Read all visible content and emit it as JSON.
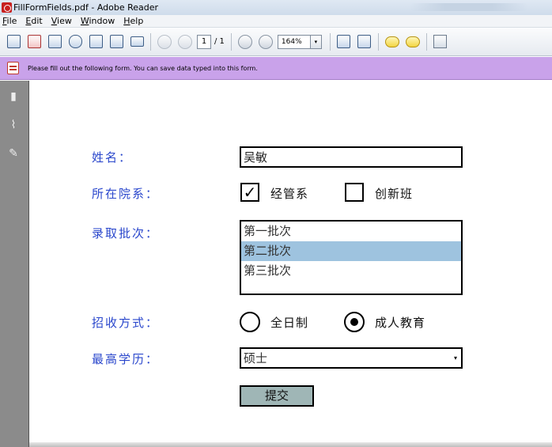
{
  "window": {
    "title": "FillFormFields.pdf - Adobe Reader"
  },
  "menu": {
    "items": [
      "File",
      "Edit",
      "View",
      "Window",
      "Help"
    ]
  },
  "toolbar": {
    "page_current": "1",
    "page_total": "/ 1",
    "zoom": "164%",
    "zoom_arrow": "▾"
  },
  "message_bar": {
    "text": "Please fill out the following form. You can save data typed into this form."
  },
  "form": {
    "name_label": "姓名：",
    "name_value": "吴敏",
    "dept_label": "所在院系：",
    "dept_options": [
      {
        "label": "经管系",
        "checked": true
      },
      {
        "label": "创新班",
        "checked": false
      }
    ],
    "check_mark": "✓",
    "batch_label": "录取批次：",
    "batch_options": [
      "第一批次",
      "第二批次",
      "第三批次"
    ],
    "batch_selected_index": 1,
    "mode_label": "招收方式：",
    "mode_options": [
      {
        "label": "全日制",
        "selected": false
      },
      {
        "label": "成人教育",
        "selected": true
      }
    ],
    "degree_label": "最高学历：",
    "degree_value": "硕士",
    "combo_arrow": "▾",
    "submit_label": "提交"
  }
}
